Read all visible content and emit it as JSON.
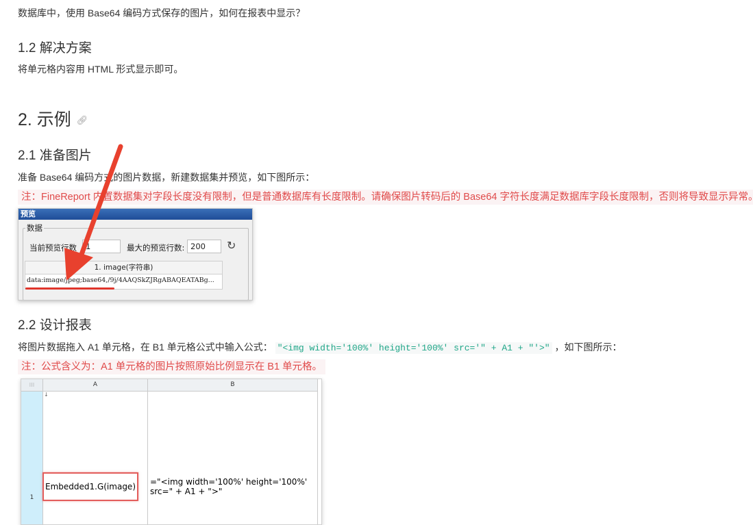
{
  "intro": {
    "question": "数据库中，使用 Base64 编码方式保存的图片，如何在报表中显示？"
  },
  "solution": {
    "heading": "1.2 解决方案",
    "text": "将单元格内容用 HTML 形式显示即可。"
  },
  "example": {
    "heading": "2. 示例",
    "link_icon": "link-icon"
  },
  "prepare": {
    "heading": "2.1 准备图片",
    "text": "准备 Base64 编码方式的图片数据，新建数据集并预览，如下图所示：",
    "note": "注：FineReport 内置数据集对字段长度没有限制，但是普通数据库有长度限制。请确保图片转码后的 Base64 字符长度满足数据库字段长度限制，否则将导致显示异常。"
  },
  "preview_window": {
    "title": "预览",
    "group_label": "数据",
    "rows_label": "当前预览行数",
    "rows_value": "1",
    "max_label": "最大的预览行数:",
    "max_value": "200",
    "refresh_icon": "refresh-icon",
    "column_header": "1. image(字符串)",
    "cell_value": "data:image/jpeg;base64,/9j/4AAQSkZJRgABAQEATABg..."
  },
  "design": {
    "heading": "2.2 设计报表",
    "text_before": "将图片数据拖入 A1 单元格，在 B1 单元格公式中输入公式：",
    "formula": "\"<img width='100%' height='100%' src='\" + A1 + \"'>\"",
    "text_after": "，如下图所示：",
    "note": "注：公式含义为：A1 单元格的图片按照原始比例显示在 B1 单元格。"
  },
  "designer": {
    "corner": "⁝⁝⁝",
    "col_a": "A",
    "col_b": "B",
    "row_1": "1",
    "cell_a1": "Embedded1.G(image)",
    "cell_b1": "=\"<img width='100%' height='100%' src=\" + A1 + \">\""
  },
  "colors": {
    "note_text": "#e04a4a",
    "note_bg": "#fbf3f4",
    "code_text": "#1fa688",
    "arrow": "#e8412e"
  }
}
